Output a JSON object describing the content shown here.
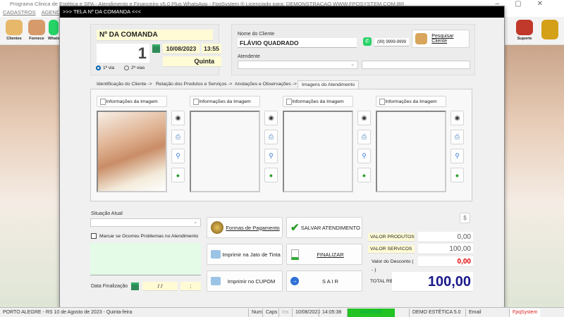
{
  "app": {
    "title": "Programa Clinica de Estética e SPA - Atendimento e Financeiro v5.0 Plus WhatsApp - FpqSystem ® Licenciado para: DEMONSTRACAO WWW.FPQSYSTEM.COM.BR",
    "menu": [
      "CADASTROS",
      "AGENDAMENTOS"
    ],
    "toolbar": [
      {
        "label": "Clientes",
        "icon": "clients-icon"
      },
      {
        "label": "Fornece",
        "icon": "supplier-icon"
      },
      {
        "label": "Whats",
        "icon": "whatsapp-icon"
      },
      {
        "label": "Suporte",
        "icon": "support-icon"
      },
      {
        "label": "",
        "icon": "exit-icon"
      }
    ]
  },
  "modal": {
    "title": ">>>   TELA Nº DA COMANDA   <<<",
    "comanda": {
      "label": "Nº DA COMANDA",
      "number": "1",
      "date": "10/08/2023",
      "time": "13:55",
      "weekday": "Quinta",
      "via1": "1ª via",
      "via2": "2ª vias",
      "via_selected": "1ª via"
    },
    "client": {
      "name_label": "Nome do Cliente",
      "name": "FLÁVIO QUADRADO",
      "phone": "(99) 9999-9999",
      "search_button": "Pesquisar Cliente",
      "attendant_label": "Atendente",
      "attendant": "",
      "attendant_extra": ""
    },
    "tabs": [
      {
        "label": "Identificação do Cliente ->"
      },
      {
        "label": "Relação dos Produtos e Serviços ->"
      },
      {
        "label": "Anotações e Observações ->"
      },
      {
        "label": "Imagens do Atendimento",
        "active": true
      }
    ],
    "images": [
      {
        "info_label": "Informações da Imagem",
        "has_image": true
      },
      {
        "info_label": "Informações da Imagem",
        "has_image": false
      },
      {
        "info_label": "Informações da Imagem",
        "has_image": false
      },
      {
        "info_label": "Informações da Imagem",
        "has_image": false
      }
    ],
    "side_icons": [
      "webcam-icon",
      "printer-icon",
      "zoom-icon",
      "add-icon"
    ],
    "situation": {
      "label": "Situação Atual",
      "value": "",
      "problem_checkbox": "Marcar se Ocorreu Problemas no Atendimento",
      "problem_checked": false,
      "notes": "",
      "finish_label": "Data Finalização",
      "finish_date": "/ /",
      "finish_time": ":"
    },
    "buttons": {
      "payment": "Formas de Pagamento",
      "save": "SALVAR  ATENDIMENTO",
      "print_inkjet": "Imprimir na Jato de Tinta",
      "finish": "FINALIZAR",
      "print_coupon": "Imprimir no CUPOM",
      "exit": "S A I R"
    },
    "values": {
      "products_label": "VALOR PRODUTOS",
      "products": "0,00",
      "services_label": "VALOR SERVICOS",
      "services": "100,00",
      "discount_label": "Valor do Desconto ( - )",
      "discount": "0,00",
      "total_label": "TOTAL R$",
      "total": "100,00"
    }
  },
  "statusbar": {
    "location": "PORTO ALEGRE - RS 10 de Agosto de 2023 - Quinta-feira",
    "num": "Num",
    "caps": "Caps",
    "ins": "Ins",
    "date": "10/08/2023",
    "time": "14:05:38",
    "user": "MASTER",
    "version": "DEMO ESTÉTICA 5.0",
    "email": "Email",
    "brand": "FpqSystem"
  },
  "colors": {
    "accent_yellow": "#fffbd5",
    "total": "#1a1a8c",
    "discount": "#e00000",
    "notes_bg": "#e3fbe7",
    "user_bar": "#22c322"
  }
}
